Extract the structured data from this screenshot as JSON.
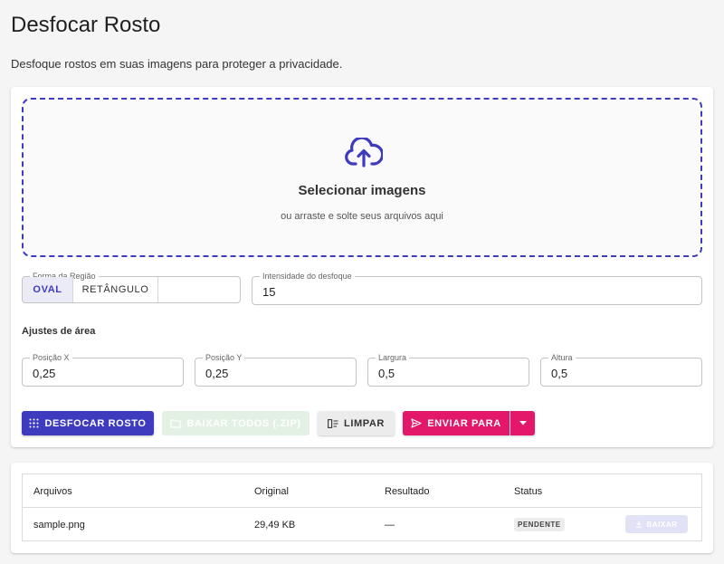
{
  "page": {
    "title": "Desfocar Rosto",
    "subtitle": "Desfoque rostos em suas imagens para proteger a privacidade."
  },
  "dropzone": {
    "icon": "cloud-upload-icon",
    "title": "Selecionar imagens",
    "hint": "ou arraste e solte seus arquivos aqui"
  },
  "region_shape": {
    "label": "Forma da Região",
    "options": [
      "OVAL",
      "RETÂNGULO"
    ],
    "selected": "OVAL"
  },
  "blur_intensity": {
    "label": "Intensidade do desfoque",
    "value": "15"
  },
  "area": {
    "section_label": "Ajustes de área",
    "pos_x": {
      "label": "Posição X",
      "value": "0,25"
    },
    "pos_y": {
      "label": "Posição Y",
      "value": "0,25"
    },
    "width": {
      "label": "Largura",
      "value": "0,5"
    },
    "height": {
      "label": "Altura",
      "value": "0,5"
    }
  },
  "actions": {
    "blur": "DESFOCAR ROSTO",
    "download_all": "BAIXAR TODOS (.ZIP)",
    "clear": "LIMPAR",
    "send_to": "ENVIAR PARA"
  },
  "files_table": {
    "columns": [
      "Arquivos",
      "Original",
      "Resultado",
      "Status"
    ],
    "rows": [
      {
        "name": "sample.png",
        "original": "29,49 KB",
        "result": "—",
        "status": "PENDENTE",
        "action": "BAIXAR"
      }
    ]
  },
  "colors": {
    "primary": "#3f3bbf",
    "accent": "#e3186b",
    "disabled_success": "#e3f1e4"
  }
}
